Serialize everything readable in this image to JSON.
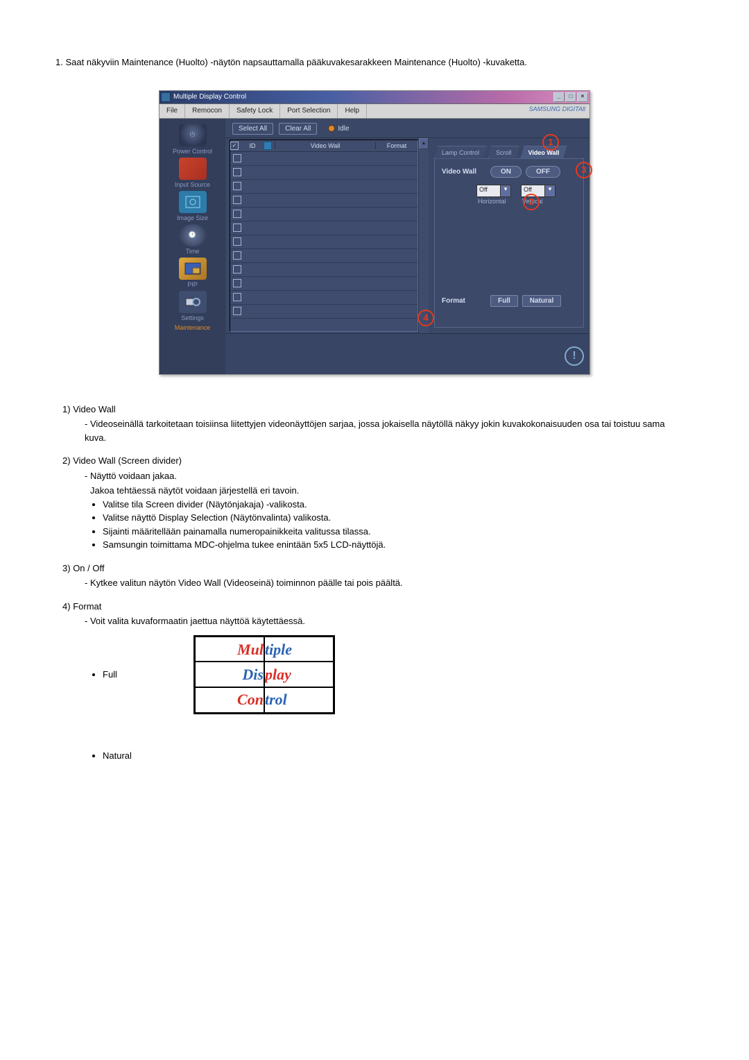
{
  "intro": "1. Saat näkyviin Maintenance (Huolto) -näytön napsauttamalla pääkuvakesarakkeen Maintenance (Huolto) -kuvaketta.",
  "window": {
    "title": "Multiple Display Control",
    "brand": "SAMSUNG DIGITAll"
  },
  "menu": [
    "File",
    "Remocon",
    "Safety Lock",
    "Port Selection",
    "Help"
  ],
  "sidebar": [
    {
      "label": "Power Control"
    },
    {
      "label": "Input Source"
    },
    {
      "label": "Image Size"
    },
    {
      "label": "Time"
    },
    {
      "label": "PIP"
    },
    {
      "label": "Settings"
    },
    {
      "label": "Maintenance"
    }
  ],
  "toolbar": {
    "select_all": "Select All",
    "clear_all": "Clear All",
    "idle": "Idle"
  },
  "table": {
    "head_id": "ID",
    "head_vw": "Video Wall",
    "head_fmt": "Format"
  },
  "panel": {
    "tabs": [
      "Lamp Control",
      "Scroll",
      "Video Wall"
    ],
    "vw_label": "Video Wall",
    "on": "ON",
    "off": "OFF",
    "sel_off1": "Off",
    "sel_off2": "Off",
    "sel_lbl1": "Horizontal",
    "sel_lbl2": "Vertical",
    "format_label": "Format",
    "full": "Full",
    "natural": "Natural"
  },
  "callouts": {
    "c1": "1",
    "c2": "2",
    "c3": "3",
    "c4": "4"
  },
  "desc": {
    "d1_num": "1)",
    "d1_title": "Video Wall",
    "d1_sub": "- Videoseinällä tarkoitetaan toisiinsa liitettyjen videonäyttöjen sarjaa, jossa jokaisella näytöllä näkyy jokin kuvakokonaisuuden osa tai toistuu sama kuva.",
    "d2_num": "2)",
    "d2_title": "Video Wall (Screen divider)",
    "d2_sub1": "- Näyttö voidaan jakaa.",
    "d2_sub2": "Jakoa tehtäessä näytöt voidaan järjestellä eri tavoin.",
    "d2_b1": "Valitse tila Screen divider (Näytönjakaja) -valikosta.",
    "d2_b2": "Valitse näyttö Display Selection (Näytönvalinta) valikosta.",
    "d2_b3": "Sijainti määritellään painamalla numeropainikkeita valitussa tilassa.",
    "d2_b4": "Samsungin toimittama MDC-ohjelma tukee enintään 5x5 LCD-näyttöjä.",
    "d3_num": "3)",
    "d3_title": "On / Off",
    "d3_sub": "- Kytkee valitun näytön Video Wall (Videoseinä) toiminnon päälle tai pois päältä.",
    "d4_num": "4)",
    "d4_title": "Format",
    "d4_sub": "- Voit valita kuvaformaatin jaettua näyttöä käytettäessä.",
    "full": "Full",
    "natural": "Natural",
    "img_txt": {
      "t1": "Mul",
      "t2": "tiple",
      "t3": "Dis",
      "t4": "play",
      "t5": "Con",
      "t6": "trol"
    }
  }
}
